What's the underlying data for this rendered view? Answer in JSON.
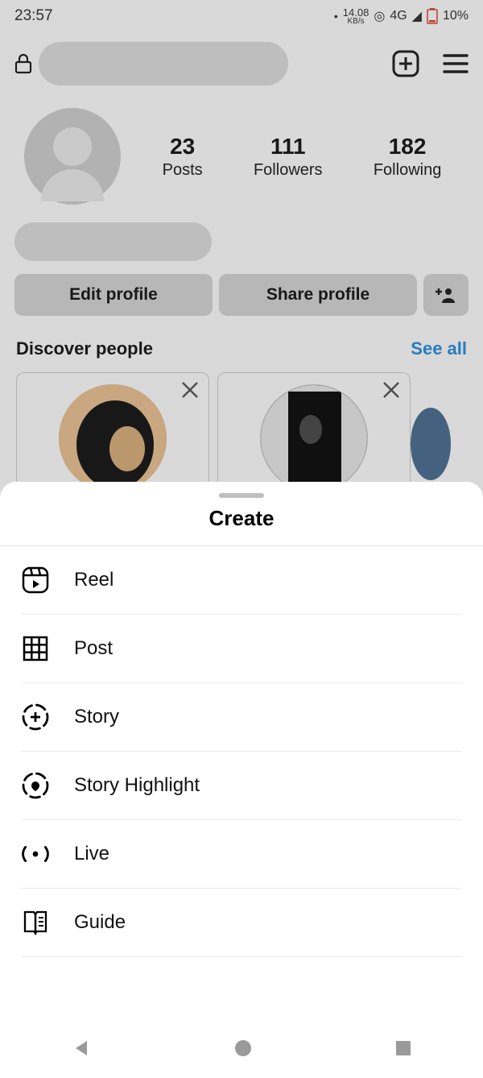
{
  "status": {
    "time": "23:57",
    "data_rate": "14.08",
    "data_unit": "KB/s",
    "network": "4G",
    "battery": "10%"
  },
  "profile": {
    "stats": [
      {
        "count": "23",
        "label": "Posts"
      },
      {
        "count": "111",
        "label": "Followers"
      },
      {
        "count": "182",
        "label": "Following"
      }
    ],
    "edit_label": "Edit profile",
    "share_label": "Share profile"
  },
  "discover": {
    "title": "Discover people",
    "see_all": "See all"
  },
  "sheet": {
    "title": "Create",
    "items": [
      {
        "icon": "reel-icon",
        "label": "Reel"
      },
      {
        "icon": "grid-icon",
        "label": "Post"
      },
      {
        "icon": "story-icon",
        "label": "Story"
      },
      {
        "icon": "highlight-icon",
        "label": "Story Highlight"
      },
      {
        "icon": "live-icon",
        "label": "Live"
      },
      {
        "icon": "guide-icon",
        "label": "Guide"
      }
    ]
  }
}
